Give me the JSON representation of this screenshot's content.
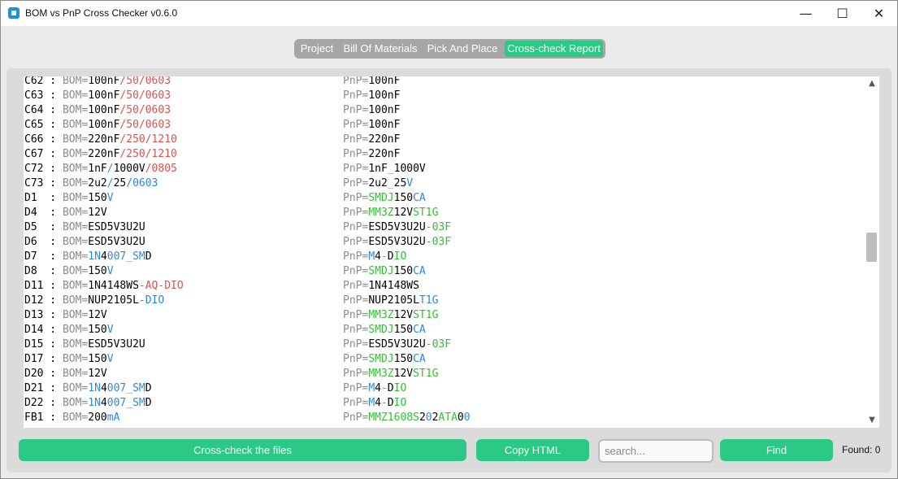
{
  "window": {
    "title": "BOM vs PnP Cross Checker v0.6.0",
    "minimize": "—",
    "maximize": "☐",
    "close": "✕"
  },
  "tabs": [
    {
      "label": "Project",
      "active": false
    },
    {
      "label": "Bill Of Materials",
      "active": false
    },
    {
      "label": "Pick And Place",
      "active": false
    },
    {
      "label": "Cross-check Report",
      "active": true
    }
  ],
  "colors": {
    "accent": "#2cc985",
    "match": "#000000",
    "prefix": "#8c8c8c",
    "mismatch_red": "#d9534f",
    "mismatch_blue": "#2f86e0",
    "mismatch_green": "#34c034"
  },
  "report": [
    {
      "ref": "C62 : ",
      "bom": [
        [
          "BOM=",
          "g"
        ],
        [
          "100nF",
          "k"
        ],
        [
          "/50/0603",
          "r"
        ]
      ],
      "pnp": [
        [
          "PnP=",
          "g"
        ],
        [
          "100nF",
          "k"
        ]
      ]
    },
    {
      "ref": "C63 : ",
      "bom": [
        [
          "BOM=",
          "g"
        ],
        [
          "100nF",
          "k"
        ],
        [
          "/50/0603",
          "r"
        ]
      ],
      "pnp": [
        [
          "PnP=",
          "g"
        ],
        [
          "100nF",
          "k"
        ]
      ]
    },
    {
      "ref": "C64 : ",
      "bom": [
        [
          "BOM=",
          "g"
        ],
        [
          "100nF",
          "k"
        ],
        [
          "/50/0603",
          "r"
        ]
      ],
      "pnp": [
        [
          "PnP=",
          "g"
        ],
        [
          "100nF",
          "k"
        ]
      ]
    },
    {
      "ref": "C65 : ",
      "bom": [
        [
          "BOM=",
          "g"
        ],
        [
          "100nF",
          "k"
        ],
        [
          "/50/0603",
          "r"
        ]
      ],
      "pnp": [
        [
          "PnP=",
          "g"
        ],
        [
          "100nF",
          "k"
        ]
      ]
    },
    {
      "ref": "C66 : ",
      "bom": [
        [
          "BOM=",
          "g"
        ],
        [
          "220nF",
          "k"
        ],
        [
          "/250/1210",
          "r"
        ]
      ],
      "pnp": [
        [
          "PnP=",
          "g"
        ],
        [
          "220nF",
          "k"
        ]
      ]
    },
    {
      "ref": "C67 : ",
      "bom": [
        [
          "BOM=",
          "g"
        ],
        [
          "220nF",
          "k"
        ],
        [
          "/250/1210",
          "r"
        ]
      ],
      "pnp": [
        [
          "PnP=",
          "g"
        ],
        [
          "220nF",
          "k"
        ]
      ]
    },
    {
      "ref": "C72 : ",
      "bom": [
        [
          "BOM=",
          "g"
        ],
        [
          "1nF",
          "k"
        ],
        [
          "/",
          "b"
        ],
        [
          "1000V",
          "k"
        ],
        [
          "/0805",
          "r"
        ]
      ],
      "pnp": [
        [
          "PnP=",
          "g"
        ],
        [
          "1nF",
          "k"
        ],
        [
          "_",
          "b"
        ],
        [
          "1000V",
          "k"
        ]
      ]
    },
    {
      "ref": "C73 : ",
      "bom": [
        [
          "BOM=",
          "g"
        ],
        [
          "2u2",
          "k"
        ],
        [
          "/",
          "b"
        ],
        [
          "25",
          "k"
        ],
        [
          "/0603",
          "b"
        ]
      ],
      "pnp": [
        [
          "PnP=",
          "g"
        ],
        [
          "2u2",
          "k"
        ],
        [
          "_",
          "b"
        ],
        [
          "25",
          "k"
        ],
        [
          "V",
          "b"
        ]
      ]
    },
    {
      "ref": "D1  : ",
      "bom": [
        [
          "BOM=",
          "g"
        ],
        [
          "150",
          "k"
        ],
        [
          "V",
          "b"
        ]
      ],
      "pnp": [
        [
          "PnP=",
          "g"
        ],
        [
          "SMDJ",
          "n"
        ],
        [
          "150",
          "k"
        ],
        [
          "CA",
          "b"
        ]
      ]
    },
    {
      "ref": "D4  : ",
      "bom": [
        [
          "BOM=",
          "g"
        ],
        [
          "12V",
          "k"
        ]
      ],
      "pnp": [
        [
          "PnP=",
          "g"
        ],
        [
          "MM3Z",
          "n"
        ],
        [
          "12V",
          "k"
        ],
        [
          "ST1G",
          "n"
        ]
      ]
    },
    {
      "ref": "D5  : ",
      "bom": [
        [
          "BOM=",
          "g"
        ],
        [
          "ESD5V3U2U",
          "k"
        ]
      ],
      "pnp": [
        [
          "PnP=",
          "g"
        ],
        [
          "ESD5V3U2U",
          "k"
        ],
        [
          "-03F",
          "n"
        ]
      ]
    },
    {
      "ref": "D6  : ",
      "bom": [
        [
          "BOM=",
          "g"
        ],
        [
          "ESD5V3U2U",
          "k"
        ]
      ],
      "pnp": [
        [
          "PnP=",
          "g"
        ],
        [
          "ESD5V3U2U",
          "k"
        ],
        [
          "-03F",
          "n"
        ]
      ]
    },
    {
      "ref": "D7  : ",
      "bom": [
        [
          "BOM=",
          "g"
        ],
        [
          "1N",
          "b"
        ],
        [
          "4",
          "k"
        ],
        [
          "007_SM",
          "b"
        ],
        [
          "D",
          "k"
        ]
      ],
      "pnp": [
        [
          "PnP=",
          "g"
        ],
        [
          "M",
          "b"
        ],
        [
          "4",
          "k"
        ],
        [
          "-",
          "n"
        ],
        [
          "D",
          "k"
        ],
        [
          "IO",
          "n"
        ]
      ]
    },
    {
      "ref": "D8  : ",
      "bom": [
        [
          "BOM=",
          "g"
        ],
        [
          "150",
          "k"
        ],
        [
          "V",
          "b"
        ]
      ],
      "pnp": [
        [
          "PnP=",
          "g"
        ],
        [
          "SMDJ",
          "n"
        ],
        [
          "150",
          "k"
        ],
        [
          "CA",
          "b"
        ]
      ]
    },
    {
      "ref": "D11 : ",
      "bom": [
        [
          "BOM=",
          "g"
        ],
        [
          "1N4148WS",
          "k"
        ],
        [
          "-AQ-DIO",
          "r"
        ]
      ],
      "pnp": [
        [
          "PnP=",
          "g"
        ],
        [
          "1N4148WS",
          "k"
        ]
      ]
    },
    {
      "ref": "D12 : ",
      "bom": [
        [
          "BOM=",
          "g"
        ],
        [
          "NUP2105L",
          "k"
        ],
        [
          "-DIO",
          "b"
        ]
      ],
      "pnp": [
        [
          "PnP=",
          "g"
        ],
        [
          "NUP2105L",
          "k"
        ],
        [
          "T1G",
          "b"
        ]
      ]
    },
    {
      "ref": "D13 : ",
      "bom": [
        [
          "BOM=",
          "g"
        ],
        [
          "12V",
          "k"
        ]
      ],
      "pnp": [
        [
          "PnP=",
          "g"
        ],
        [
          "MM3Z",
          "n"
        ],
        [
          "12V",
          "k"
        ],
        [
          "ST1G",
          "n"
        ]
      ]
    },
    {
      "ref": "D14 : ",
      "bom": [
        [
          "BOM=",
          "g"
        ],
        [
          "150",
          "k"
        ],
        [
          "V",
          "b"
        ]
      ],
      "pnp": [
        [
          "PnP=",
          "g"
        ],
        [
          "SMDJ",
          "n"
        ],
        [
          "150",
          "k"
        ],
        [
          "CA",
          "b"
        ]
      ]
    },
    {
      "ref": "D15 : ",
      "bom": [
        [
          "BOM=",
          "g"
        ],
        [
          "ESD5V3U2U",
          "k"
        ]
      ],
      "pnp": [
        [
          "PnP=",
          "g"
        ],
        [
          "ESD5V3U2U",
          "k"
        ],
        [
          "-03F",
          "n"
        ]
      ]
    },
    {
      "ref": "D17 : ",
      "bom": [
        [
          "BOM=",
          "g"
        ],
        [
          "150",
          "k"
        ],
        [
          "V",
          "b"
        ]
      ],
      "pnp": [
        [
          "PnP=",
          "g"
        ],
        [
          "SMDJ",
          "n"
        ],
        [
          "150",
          "k"
        ],
        [
          "CA",
          "b"
        ]
      ]
    },
    {
      "ref": "D20 : ",
      "bom": [
        [
          "BOM=",
          "g"
        ],
        [
          "12V",
          "k"
        ]
      ],
      "pnp": [
        [
          "PnP=",
          "g"
        ],
        [
          "MM3Z",
          "n"
        ],
        [
          "12V",
          "k"
        ],
        [
          "ST1G",
          "n"
        ]
      ]
    },
    {
      "ref": "D21 : ",
      "bom": [
        [
          "BOM=",
          "g"
        ],
        [
          "1N",
          "b"
        ],
        [
          "4",
          "k"
        ],
        [
          "007_SM",
          "b"
        ],
        [
          "D",
          "k"
        ]
      ],
      "pnp": [
        [
          "PnP=",
          "g"
        ],
        [
          "M",
          "b"
        ],
        [
          "4",
          "k"
        ],
        [
          "-",
          "n"
        ],
        [
          "D",
          "k"
        ],
        [
          "IO",
          "n"
        ]
      ]
    },
    {
      "ref": "D22 : ",
      "bom": [
        [
          "BOM=",
          "g"
        ],
        [
          "1N",
          "b"
        ],
        [
          "4",
          "k"
        ],
        [
          "007_SM",
          "b"
        ],
        [
          "D",
          "k"
        ]
      ],
      "pnp": [
        [
          "PnP=",
          "g"
        ],
        [
          "M",
          "b"
        ],
        [
          "4",
          "k"
        ],
        [
          "-",
          "n"
        ],
        [
          "D",
          "k"
        ],
        [
          "IO",
          "n"
        ]
      ]
    },
    {
      "ref": "FB1 : ",
      "bom": [
        [
          "BOM=",
          "g"
        ],
        [
          "200",
          "k"
        ],
        [
          "mA",
          "b"
        ]
      ],
      "pnp": [
        [
          "PnP=",
          "g"
        ],
        [
          "MMZ1608S",
          "n"
        ],
        [
          "2",
          "k"
        ],
        [
          "0",
          "b"
        ],
        [
          "2",
          "k"
        ],
        [
          "ATA",
          "n"
        ],
        [
          "0",
          "k"
        ],
        [
          "0",
          "b"
        ]
      ]
    }
  ],
  "scrollbar": {
    "up": "▲",
    "down": "▼",
    "position": 0.45
  },
  "bottom": {
    "crosscheck_label": "Cross-check the files",
    "copy_label": "Copy HTML",
    "search_placeholder": "search...",
    "search_value": "",
    "find_label": "Find",
    "found_text": "Found: 0"
  }
}
